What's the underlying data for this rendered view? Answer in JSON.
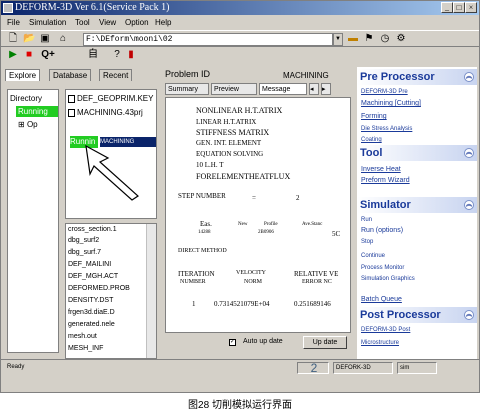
{
  "window": {
    "title": "DEFORM-3D Ver 6.1(Service Pack 1)"
  },
  "menu": [
    "File",
    "Simulation",
    "Tool",
    "View",
    "Option",
    "Help"
  ],
  "toolbar": {
    "path": "F:\\DEform\\mooni\\02"
  },
  "left_tabs": [
    "Explore",
    "Database",
    "Recent"
  ],
  "directory": {
    "header": "Directory",
    "running": "Running",
    "child": "Op"
  },
  "files": [
    "DEF_GEOPRIM.KEY",
    "MACHINING.43prj",
    "MACHINING"
  ],
  "running_badge": "Runnin",
  "bottom_list": [
    "cross_section.1",
    "dbg_surf2",
    "dbg_surf.7",
    "DEF_MAILINI",
    "DEF_MGH.ACT",
    "DEFORMED.PROB",
    "DENSITY.DST",
    "frgen3d.diaE.D",
    "generated.nele",
    "mesh.out",
    "MESH_INF"
  ],
  "problem": {
    "label": "Problem ID",
    "value": "MACHINING"
  },
  "mid_tabs": [
    "Summary",
    "Preview",
    "Message"
  ],
  "message": {
    "lines": [
      "NONLINEAR H.T.ATRIX",
      "LINEAR H.T.ATRIX",
      "STIFFNESS MATRIX",
      "GEN. INT. ELEMENT",
      "EQUATION SOLVING",
      "10 L.H. T",
      "FORELEMENTHEATFLUX"
    ],
    "step": "STEP NUMBER",
    "step_eq": "=",
    "step_val": "2",
    "eas_label": "Eas.",
    "new_label": "New",
    "profile_label": "Profile",
    "avestanc_label": "Ave.Stanc",
    "eas_val": "14288",
    "new_val": "2B0906",
    "avestanc_val": "5C",
    "direct_method": "DIRECT METHOD",
    "iter_col1": "ITERATION",
    "iter_col1b": "NUMBER",
    "iter_col2": "VELOCITY",
    "iter_col2b": "NORM",
    "iter_col3": "RELATIVE VE",
    "iter_col3b": "ERROR NC",
    "iter_num": "1",
    "iter_norm": "0.7314521079E+04",
    "iter_err": "0.251689146"
  },
  "footer": {
    "autoupdate": "Auto up date",
    "update_btn": "Up date"
  },
  "pre": {
    "title": "Pre Processor",
    "items": [
      "DEFORM-3D Pre",
      "Machining [Cutting]",
      "Forming",
      "Die Stress Analysis",
      "Coating"
    ]
  },
  "tool": {
    "title": "Tool",
    "items": [
      "Inverse Heat",
      "Preform Wizard"
    ]
  },
  "simulator": {
    "title": "Simulator",
    "items": [
      "Run",
      "Run (options)",
      "Stop",
      "Continue",
      "Process Monitor",
      "Simulation Graphics",
      "Batch Queue"
    ]
  },
  "post": {
    "title": "Post Processor",
    "items": [
      "DEFORM-3D Post",
      "Microstructure"
    ]
  },
  "status": {
    "ready": "Ready",
    "num": "2",
    "app": "DEFORK-3D",
    "user": "sim"
  },
  "caption": "图28  切削模拟运行界面"
}
